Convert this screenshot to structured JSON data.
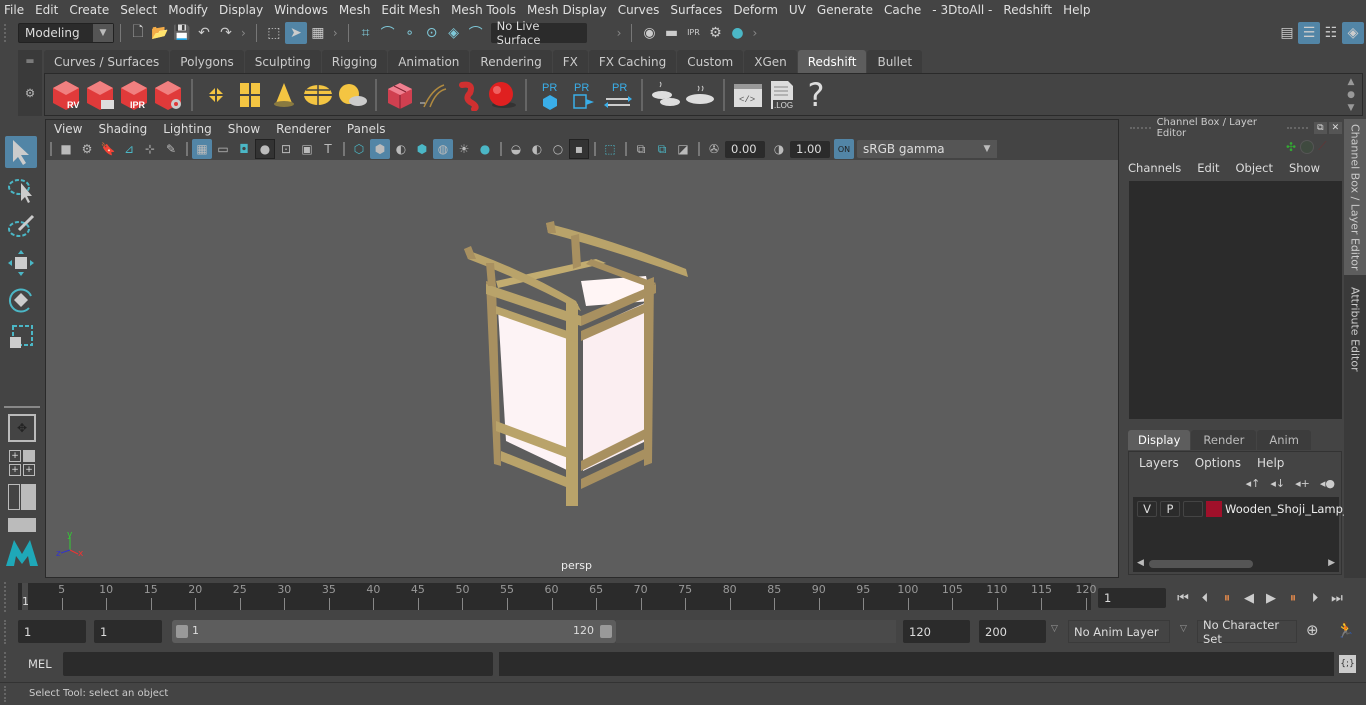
{
  "menubar": {
    "items": [
      "File",
      "Edit",
      "Create",
      "Select",
      "Modify",
      "Display",
      "Windows",
      "Mesh",
      "Edit Mesh",
      "Mesh Tools",
      "Mesh Display",
      "Curves",
      "Surfaces",
      "Deform",
      "UV",
      "Generate",
      "Cache",
      "- 3DtoAll -",
      "Redshift",
      "Help"
    ]
  },
  "statusline": {
    "workspace_menu": "Modeling",
    "live_surface": "No Live Surface"
  },
  "shelf": {
    "tabs": [
      "Curves / Surfaces",
      "Polygons",
      "Sculpting",
      "Rigging",
      "Animation",
      "Rendering",
      "FX",
      "FX Caching",
      "Custom",
      "XGen",
      "Redshift",
      "Bullet"
    ],
    "active_tab": "Redshift",
    "buttons": [
      {
        "icon": "redshift-render-view-icon",
        "label": "RV"
      },
      {
        "icon": "redshift-batch-render-icon",
        "label": ""
      },
      {
        "icon": "redshift-ipr-icon",
        "label": "IPR"
      },
      {
        "icon": "redshift-settings-icon",
        "label": ""
      },
      {
        "icon": "redshift-area-light-icon",
        "label": ""
      },
      {
        "icon": "redshift-portal-light-icon",
        "label": ""
      },
      {
        "icon": "redshift-spot-light-icon",
        "label": ""
      },
      {
        "icon": "redshift-dome-light-icon",
        "label": ""
      },
      {
        "icon": "redshift-sun-sky-icon",
        "label": ""
      },
      {
        "icon": "redshift-proxy-icon",
        "label": ""
      },
      {
        "icon": "redshift-hair-icon",
        "label": ""
      },
      {
        "icon": "redshift-volume-icon",
        "label": ""
      },
      {
        "icon": "redshift-sphere-icon",
        "label": ""
      },
      {
        "icon": "proxy-create-icon",
        "label": "PR"
      },
      {
        "icon": "proxy-export-icon",
        "label": "PR"
      },
      {
        "icon": "proxy-convert-icon",
        "label": "PR"
      },
      {
        "icon": "bake-set-icon",
        "label": ""
      },
      {
        "icon": "bake-icon",
        "label": ""
      },
      {
        "icon": "script-editor-icon",
        "label": ""
      },
      {
        "icon": "log-icon",
        "label": ".LOG"
      },
      {
        "icon": "help-icon",
        "label": "?"
      }
    ]
  },
  "viewport": {
    "menu": [
      "View",
      "Shading",
      "Lighting",
      "Show",
      "Renderer",
      "Panels"
    ],
    "exposure": "0.00",
    "gamma": "1.00",
    "color_space": "sRGB gamma",
    "camera_label": "persp",
    "axis": {
      "x": "x",
      "y": "y",
      "z": "z"
    }
  },
  "channel_box": {
    "title": "Channel Box / Layer Editor",
    "menu": [
      "Channels",
      "Edit",
      "Object",
      "Show"
    ]
  },
  "layer_editor": {
    "tabs": [
      "Display",
      "Render",
      "Anim"
    ],
    "active_tab": "Display",
    "menu": [
      "Layers",
      "Options",
      "Help"
    ],
    "layers": [
      {
        "visible": "V",
        "playback": "P",
        "color": "#a0102a",
        "name": "Wooden_Shoji_Lamp_"
      }
    ]
  },
  "side_tabs": [
    "Channel Box / Layer Editor",
    "Attribute Editor"
  ],
  "timeline": {
    "current_frame_marker": "1",
    "ticks": [
      5,
      10,
      15,
      20,
      25,
      30,
      35,
      40,
      45,
      50,
      55,
      60,
      65,
      70,
      75,
      80,
      85,
      90,
      95,
      100,
      105,
      110,
      115,
      120
    ],
    "min": 1,
    "max": 120,
    "current_frame": "1"
  },
  "range": {
    "start": "1",
    "playback_start": "1",
    "slider_min": "1",
    "slider_max": "120",
    "playback_end": "120",
    "end": "200",
    "anim_layer": "No Anim Layer",
    "character_set": "No Character Set"
  },
  "command": {
    "language": "MEL",
    "input": "",
    "result": ""
  },
  "help_line": "Select Tool: select an object",
  "colors": {
    "accent": "#5285a6",
    "redshift_red": "#e03a3a",
    "light_yellow": "#f4c542",
    "proxy_blue": "#3aaee8",
    "layer_color": "#a0102a"
  }
}
